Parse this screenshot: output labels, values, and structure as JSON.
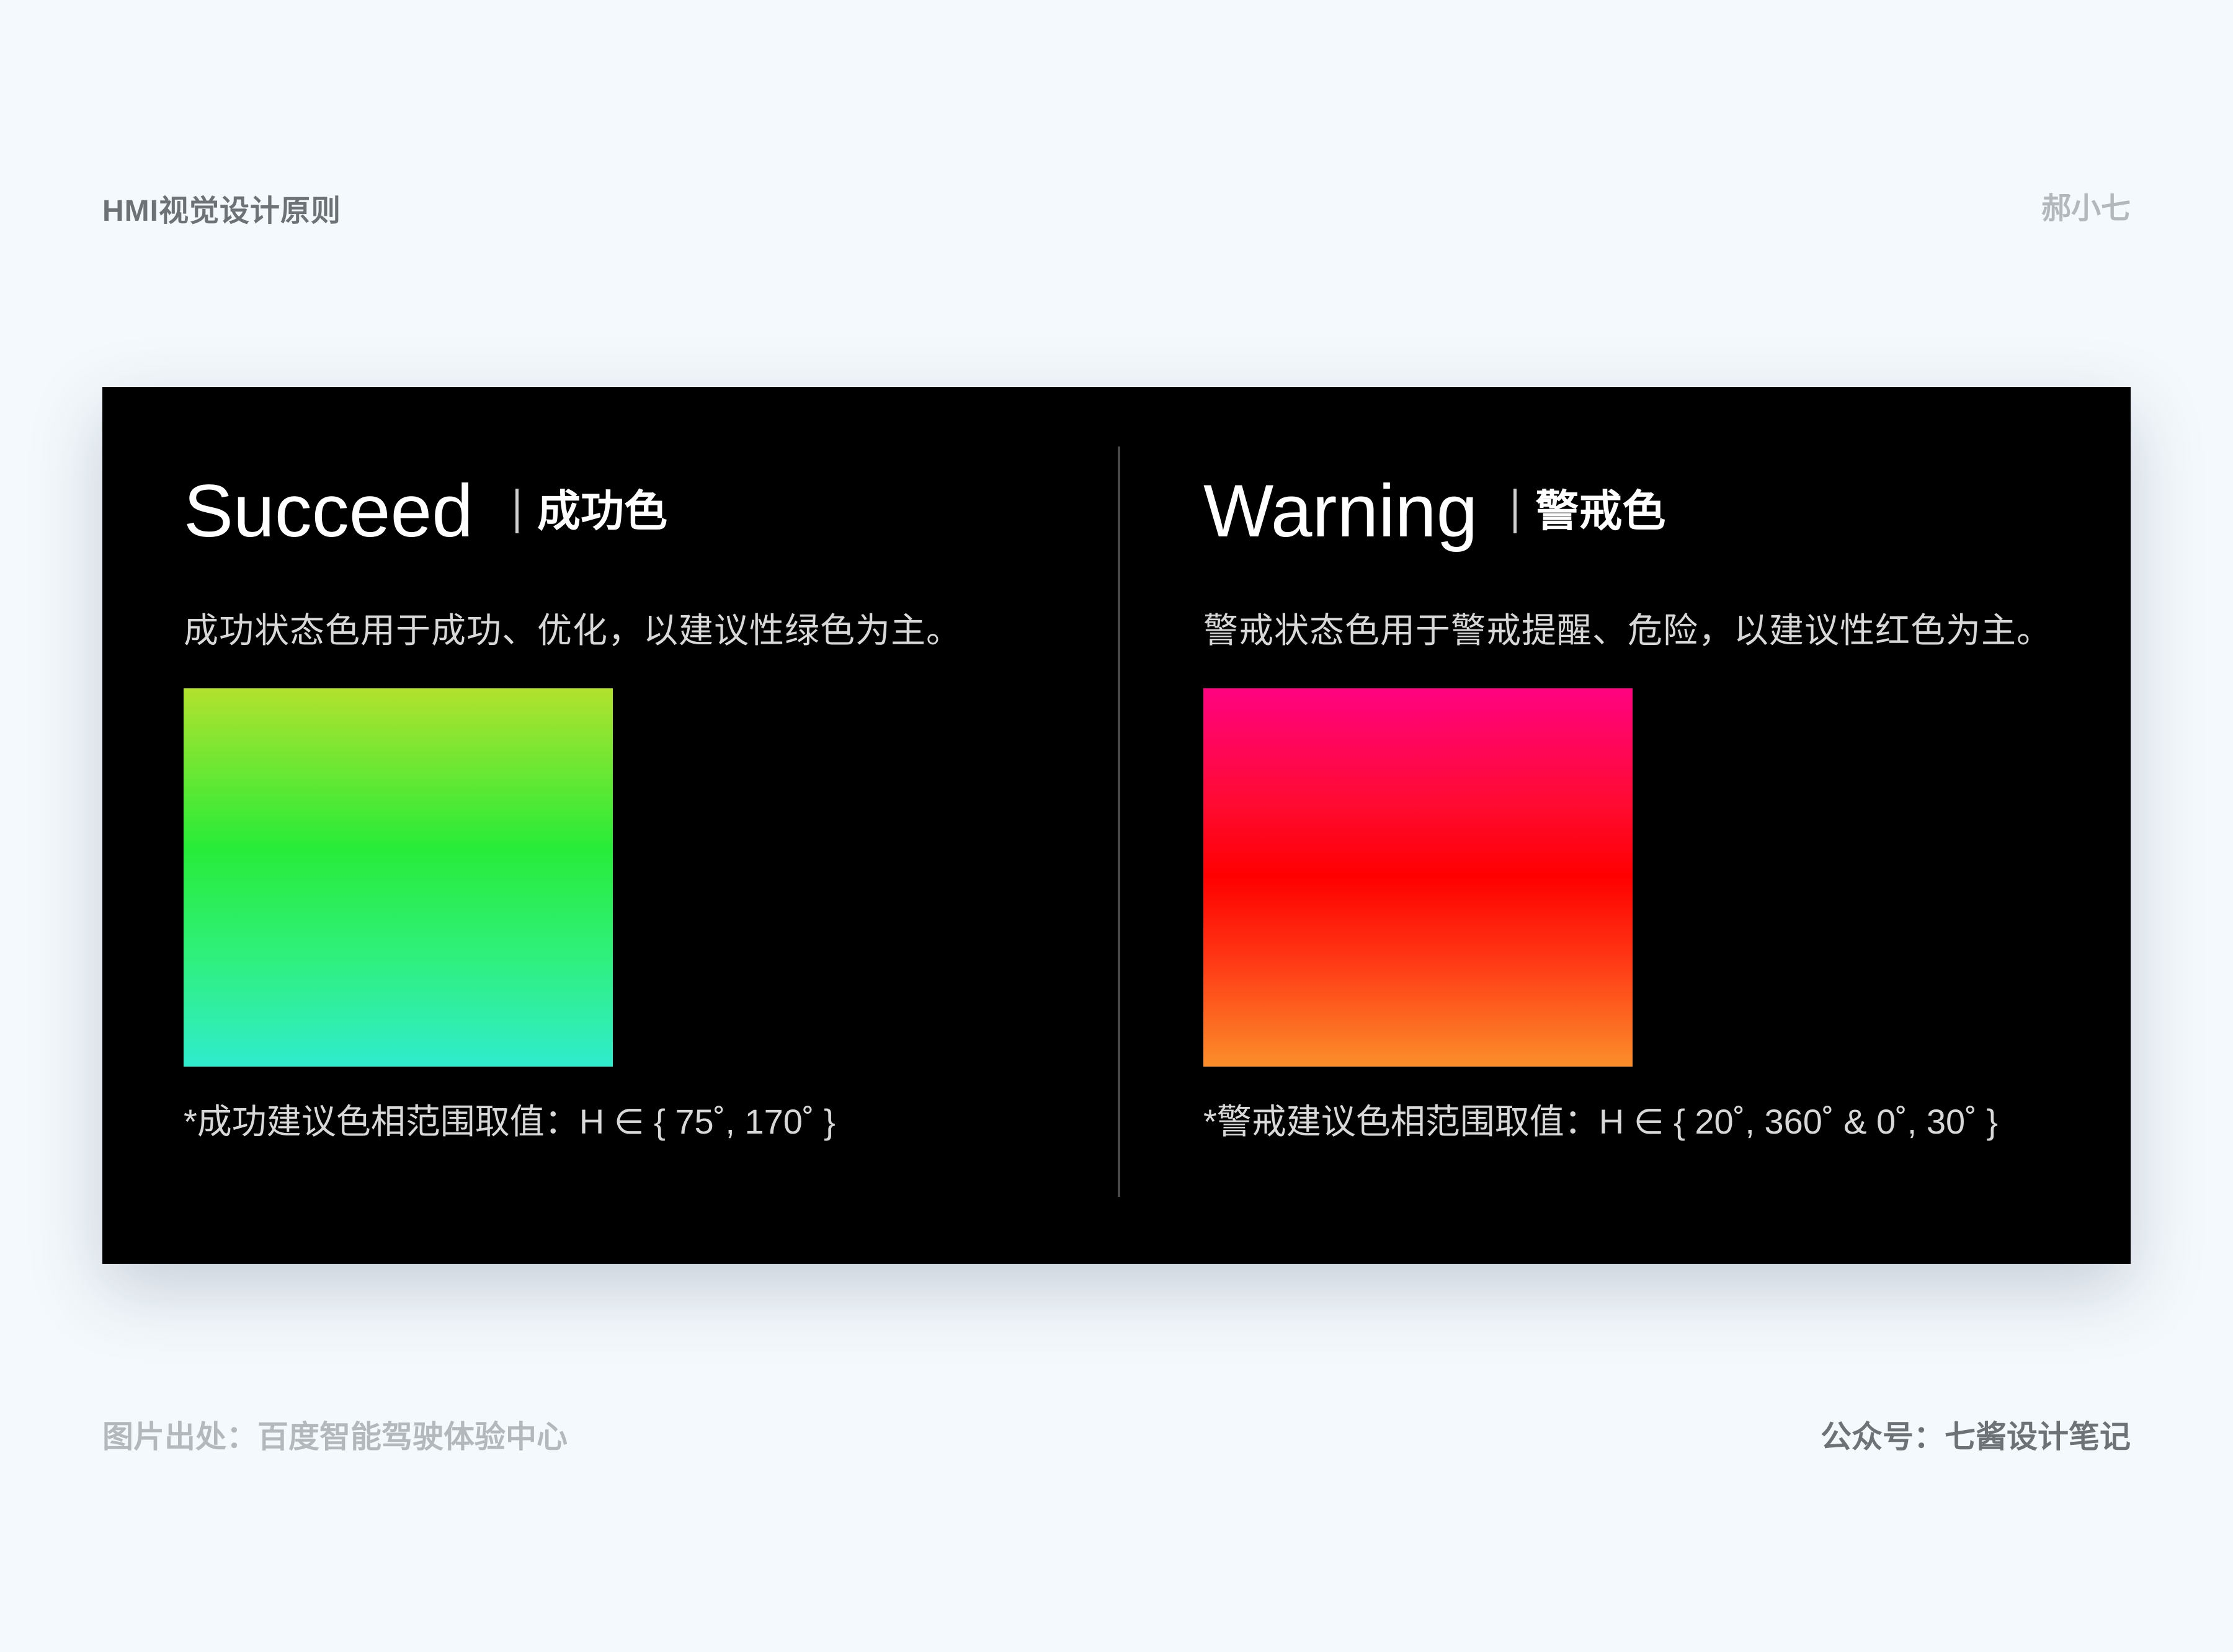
{
  "header": {
    "title": "HMI视觉设计原则",
    "author": "郝小七"
  },
  "card": {
    "succeed": {
      "title_en": "Succeed",
      "title_cn": "成功色",
      "description": "成功状态色用于成功、优化，以建议性绿色为主。",
      "note": "*成功建议色相范围取值：H ∈ { 75˚, 170˚ }",
      "gradient_colors": [
        "#b2e22e",
        "#28ec38",
        "#2ff07a",
        "#30eccd"
      ]
    },
    "warning": {
      "title_en": "Warning",
      "title_cn": "警戒色",
      "description": "警戒状态色用于警戒提醒、危险，以建议性红色为主。",
      "note": "*警戒建议色相范围取值：H ∈ { 20˚, 360˚ & 0˚, 30˚ }",
      "gradient_colors": [
        "#ff0380",
        "#ff0000",
        "#ff3815",
        "#fb8e2a"
      ]
    }
  },
  "footer": {
    "source": "图片出处：百度智能驾驶体验中心",
    "account": "公众号：七酱设计笔记"
  }
}
